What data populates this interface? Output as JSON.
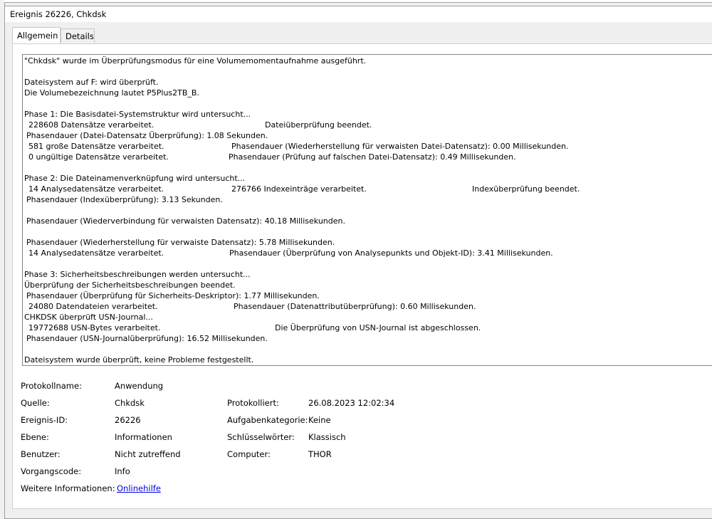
{
  "title": "Ereignis 26226, Chkdsk",
  "tabs": [
    {
      "label": "Allgemein",
      "active": true
    },
    {
      "label": "Details",
      "active": false
    }
  ],
  "message": {
    "l1": "\"Chkdsk\" wurde im Überprüfungsmodus für eine Volumemomentaufnahme ausgeführt.",
    "l2": "Dateisystem auf F: wird überprüft.",
    "l3": "Die Volumebezeichnung lautet P5Plus2TB_B.",
    "l4": "Phase 1: Die Basisdatei-Systemstruktur wird untersucht...",
    "l5a": "228608 Datensätze verarbeitet.",
    "l5b": "Dateiüberprüfung beendet.",
    "l6": "Phasendauer (Datei-Datensatz Überprüfung): 1.08 Sekunden.",
    "l7a": "581 große Datensätze verarbeitet.",
    "l7b": "Phasendauer (Wiederherstellung für verwaisten Datei-Datensatz): 0.00 Millisekunden.",
    "l8a": "0 ungültige Datensätze verarbeitet.",
    "l8b": "Phasendauer (Prüfung auf falschen Datei-Datensatz): 0.49 Millisekunden.",
    "l9": "Phase 2: Die Dateinamenverknüpfung wird untersucht...",
    "l10a": "14 Analysedatensätze verarbeitet.",
    "l10b": "276766 Indexeinträge verarbeitet.",
    "l10c": "Indexüberprüfung beendet.",
    "l11": "Phasendauer (Indexüberprüfung): 3.13 Sekunden.",
    "l12": "Phasendauer (Wiederverbindung für verwaisten Datensatz): 40.18 Millisekunden.",
    "l13": "Phasendauer (Wiederherstellung für verwaiste Datensatz): 5.78 Millisekunden.",
    "l14a": "14 Analysedatensätze verarbeitet.",
    "l14b": "Phasendauer (Überprüfung von Analysepunkts und Objekt-ID): 3.41 Millisekunden.",
    "l15": "Phase 3: Sicherheitsbeschreibungen werden untersucht...",
    "l16": "Überprüfung der Sicherheitsbeschreibungen beendet.",
    "l17": "Phasendauer (Überprüfung für Sicherheits-Deskriptor): 1.77 Millisekunden.",
    "l18a": "24080 Datendateien verarbeitet.",
    "l18b": "Phasendauer (Datenattributüberprüfung): 0.60 Millisekunden.",
    "l19": "CHKDSK überprüft USN-Journal...",
    "l20a": "19772688 USN-Bytes verarbeitet.",
    "l20b": "Die Überprüfung von USN-Journal ist abgeschlossen.",
    "l21": "Phasendauer (USN-Journalüberprüfung): 16.52 Millisekunden.",
    "l22": "Dateisystem wurde überprüft, keine Probleme festgestellt."
  },
  "meta": {
    "protokollname_label": "Protokollname:",
    "protokollname_value": "Anwendung",
    "quelle_label": "Quelle:",
    "quelle_value": "Chkdsk",
    "protokolliert_label": "Protokolliert:",
    "protokolliert_value": "26.08.2023 12:02:34",
    "ereignis_label": "Ereignis-ID:",
    "ereignis_value": "26226",
    "aufgabe_label": "Aufgabenkategorie:",
    "aufgabe_value": "Keine",
    "ebene_label": "Ebene:",
    "ebene_value": "Informationen",
    "schluessel_label": "Schlüsselwörter:",
    "schluessel_value": "Klassisch",
    "benutzer_label": "Benutzer:",
    "benutzer_value": "Nicht zutreffend",
    "computer_label": "Computer:",
    "computer_value": "THOR",
    "vorgang_label": "Vorgangscode:",
    "vorgang_value": "Info",
    "weitere_label": "Weitere Informationen:",
    "weitere_link": "Onlinehilfe"
  },
  "colors": {
    "link": "#0000e0",
    "panel_bg": "#f0f0f0"
  }
}
